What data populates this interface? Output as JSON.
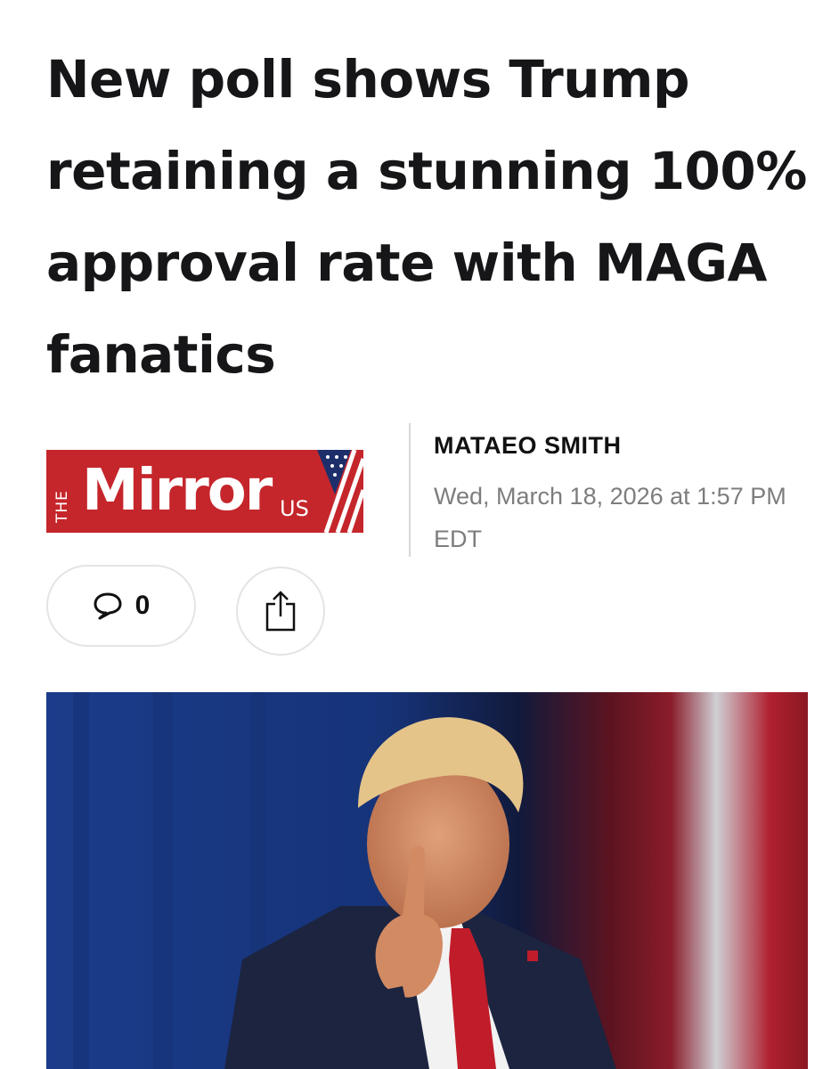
{
  "article": {
    "headline": "New poll shows Trump retaining a stunning 100% approval rate with MAGA fanatics",
    "author": "MATAEO SMITH",
    "published": "Wed, March 18, 2026 at 1:57 PM EDT"
  },
  "publisher": {
    "prefix": "THE",
    "name": "Mirror",
    "region": "US",
    "brand_color": "#c5262b"
  },
  "actions": {
    "comment_count": "0",
    "comment_icon": "speech-bubble-icon",
    "share_icon": "share-icon"
  },
  "hero_image": {
    "subject": "photo of man in suit pointing finger in front of blue curtain and flag"
  }
}
